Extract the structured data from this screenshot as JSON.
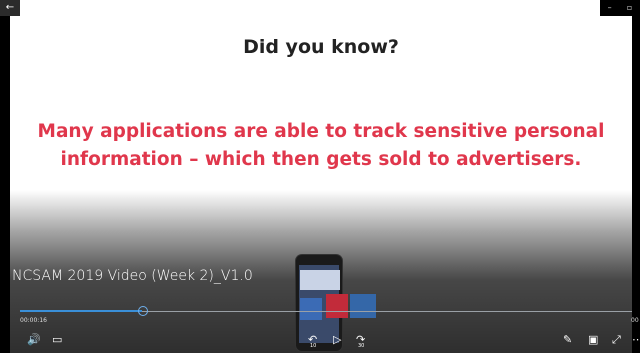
{
  "window": {
    "back_glyph": "←",
    "minimize_glyph": "–",
    "restore_glyph": "▫"
  },
  "slide": {
    "title": "Did you know?",
    "body": "Many applications are able to track sensitive personal information – which then gets sold to advertisers.",
    "title_color": "#222222",
    "body_color": "#e0374c"
  },
  "player": {
    "video_title": "NCSAM 2019 Video (Week 2)_V1.0",
    "elapsed": "00:00:16",
    "total": "00",
    "progress_fraction": 0.2,
    "accent": "#3a8fd8",
    "prev_glyph": "‹",
    "controls": {
      "volume_icon": "🔊",
      "captions_icon": "▭",
      "back10_glyph": "↶",
      "back10_label": "10",
      "play_glyph": "▷",
      "fwd30_glyph": "↷",
      "fwd30_label": "30",
      "pen_icon": "✎",
      "miniview_icon": "▣",
      "fullscreen_icon": "⤢",
      "more_icon": "⋯"
    }
  }
}
